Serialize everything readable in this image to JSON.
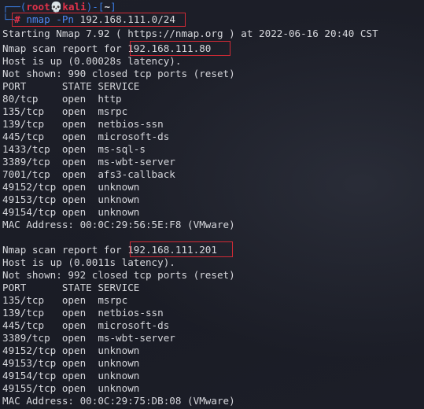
{
  "prompt": {
    "top_open": "┌──(",
    "user": "root",
    "skull": "💀",
    "host": "kali",
    "mid": ")-[",
    "dir": "~",
    "close": "]",
    "bottom": "└─",
    "hash": "#",
    "command": "nmap -Pn",
    "command_arg": "192.168.111.0/24"
  },
  "output": [
    "Starting Nmap 7.92 ( https://nmap.org ) at 2022-06-16 20:40 CST",
    "Nmap scan report for 192.168.111.80",
    "Host is up (0.00028s latency).",
    "Not shown: 990 closed tcp ports (reset)",
    "PORT      STATE SERVICE",
    "80/tcp    open  http",
    "135/tcp   open  msrpc",
    "139/tcp   open  netbios-ssn",
    "445/tcp   open  microsoft-ds",
    "1433/tcp  open  ms-sql-s",
    "3389/tcp  open  ms-wbt-server",
    "7001/tcp  open  afs3-callback",
    "49152/tcp open  unknown",
    "49153/tcp open  unknown",
    "49154/tcp open  unknown",
    "MAC Address: 00:0C:29:56:5E:F8 (VMware)",
    "",
    "Nmap scan report for 192.168.111.201",
    "Host is up (0.0011s latency).",
    "Not shown: 992 closed tcp ports (reset)",
    "PORT      STATE SERVICE",
    "135/tcp   open  msrpc",
    "139/tcp   open  netbios-ssn",
    "445/tcp   open  microsoft-ds",
    "3389/tcp  open  ms-wbt-server",
    "49152/tcp open  unknown",
    "49153/tcp open  unknown",
    "49154/tcp open  unknown",
    "49155/tcp open  unknown",
    "MAC Address: 00:0C:29:75:DB:08 (VMware)"
  ],
  "colors": {
    "background": "#1b1d27",
    "text": "#d6d7dc",
    "prompt_bracket": "#3a7be0",
    "prompt_user": "#e0324a",
    "command": "#4e86f0",
    "highlight_box": "#d22a35"
  }
}
